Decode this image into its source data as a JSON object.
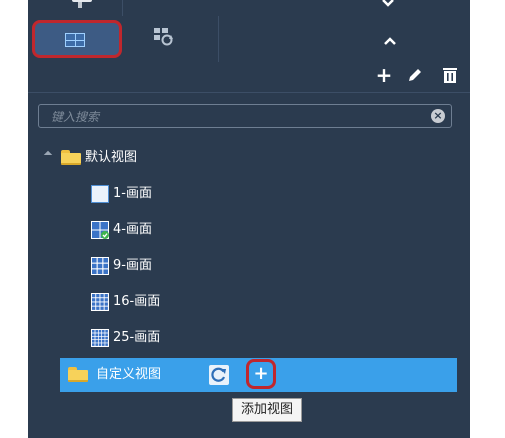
{
  "search": {
    "placeholder": "键入搜索"
  },
  "tree": {
    "default_group": "默认视图",
    "layouts": [
      {
        "label": "1-画面",
        "icon": "layout-1-icon"
      },
      {
        "label": "4-画面",
        "icon": "layout-4-icon"
      },
      {
        "label": "9-画面",
        "icon": "layout-9-icon"
      },
      {
        "label": "16-画面",
        "icon": "layout-16-icon"
      },
      {
        "label": "25-画面",
        "icon": "layout-25-icon"
      }
    ],
    "custom_group": "自定义视图"
  },
  "tooltip": {
    "text": "添加视图"
  },
  "colors": {
    "panel": "#2b3b4f",
    "selected_row": "#3aa0ea",
    "highlight": "#c0272d"
  }
}
